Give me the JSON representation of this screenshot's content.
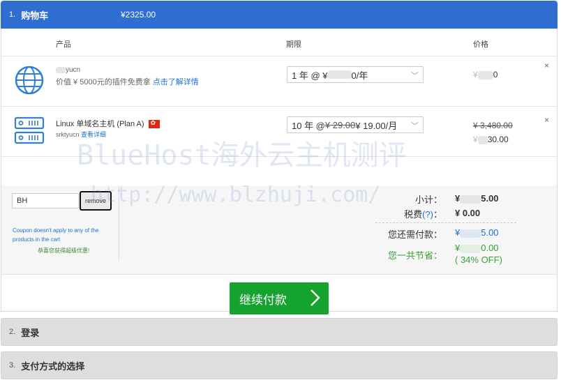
{
  "header": {
    "step_num": "1.",
    "title": "购物车",
    "total": "¥2325.00"
  },
  "columns": {
    "product": "产品",
    "period": "期限",
    "price": "价格"
  },
  "items": [
    {
      "name": "yucn",
      "desc": "价值 ¥ 5000元的插件免费拿",
      "desc_link": "点击了解详情",
      "period": "1 年 @ ¥",
      "period_suffix": "0/年",
      "price_prefix": "¥",
      "price_suffix": "0",
      "close": "×"
    },
    {
      "name": "Linux 单域名主机 (Plan A)",
      "sub": "srktyucn",
      "sub_link": "查看详细",
      "period_a": "10 年 @ ",
      "period_strike": "¥ 29.00",
      "period_b": " ¥ 19.00/月",
      "price_strike": "¥ 3,480.00",
      "price_prefix": "¥",
      "price_suffix": "30.00",
      "close": "×"
    }
  ],
  "coupon": {
    "value": "BH",
    "remove_label": "remove",
    "message": "Coupon doesn't apply to any of the products in the cart",
    "success": "恭喜您获得超级优惠!"
  },
  "summary": {
    "subtotal_label": "小计：",
    "subtotal_prefix": "¥",
    "subtotal_suffix": "5.00",
    "tax_label": "税费",
    "tax_help": "(?)",
    "tax_colon": "：",
    "tax_value": "¥ 0.00",
    "due_label": "您还需付款：",
    "due_prefix": "¥",
    "due_suffix": "5.00",
    "save_label": "您一共节省：",
    "save_prefix": "¥",
    "save_suffix": "0.00",
    "save_pct": "( 34% OFF)"
  },
  "checkout": {
    "label": "继续付款"
  },
  "steps": [
    {
      "num": "2.",
      "title": "登录"
    },
    {
      "num": "3.",
      "title": "支付方式的选择"
    }
  ],
  "watermark": {
    "line1": "BlueHost海外云主机测评",
    "line2": "http://www.blzhuji.com/"
  },
  "colors": {
    "primary": "#2f6fd1",
    "checkout": "#13a32e",
    "save": "#3aa03a"
  }
}
